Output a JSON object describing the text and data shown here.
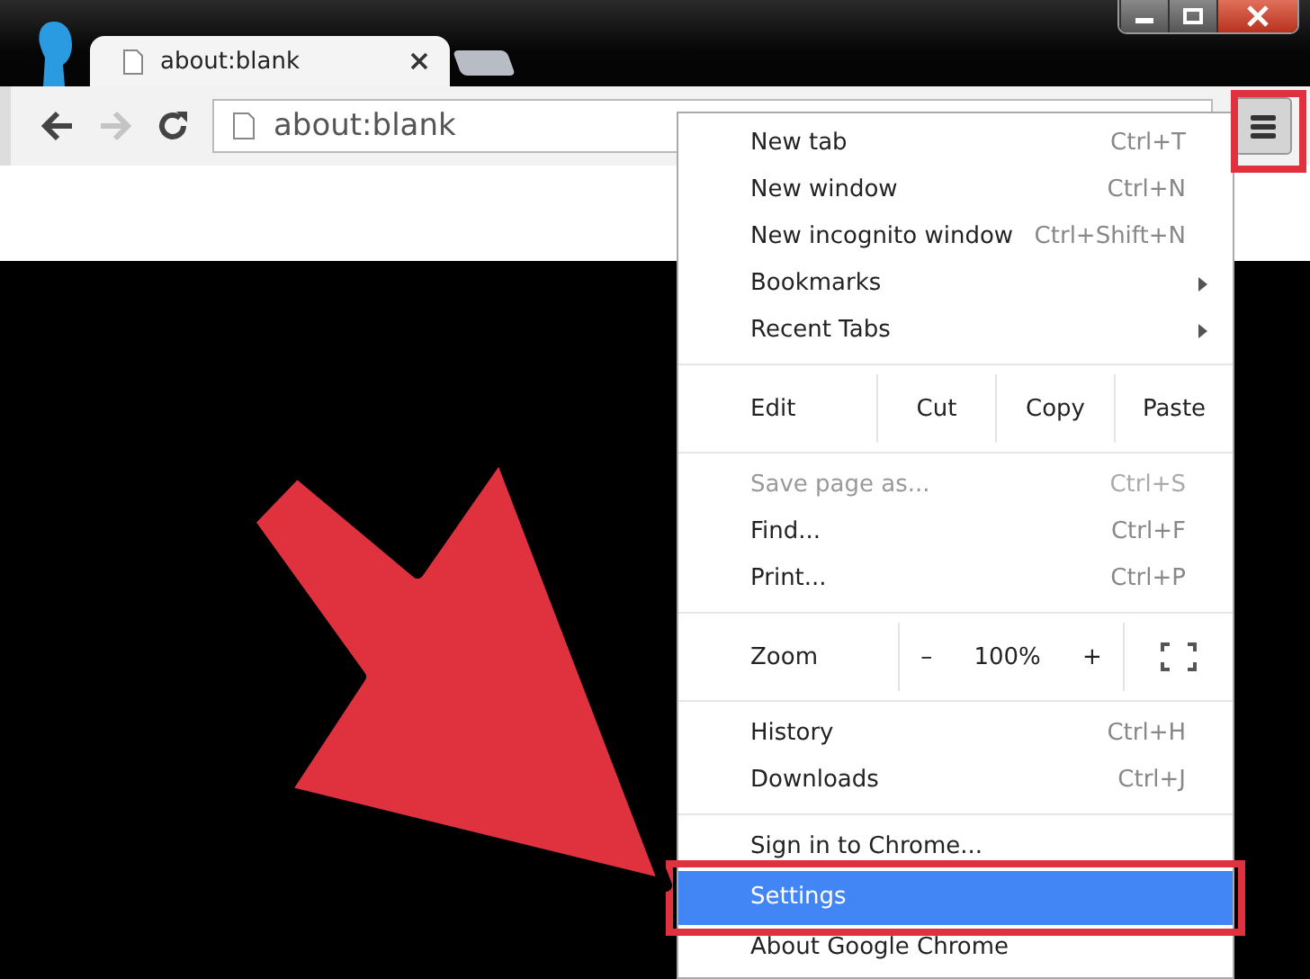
{
  "tabs": [
    {
      "label": "about:blank",
      "selected": true
    }
  ],
  "toolbar": {
    "back_disabled": false,
    "forward_disabled": true,
    "address": "about:blank",
    "menu_button_callout": true
  },
  "menu": [
    {
      "kind": "item",
      "label": "New tab",
      "shortcut": "Ctrl+T",
      "disabled": false,
      "selected": false,
      "callout": false
    },
    {
      "kind": "item",
      "label": "New window",
      "shortcut": "Ctrl+N",
      "disabled": false,
      "selected": false,
      "callout": false
    },
    {
      "kind": "item",
      "label": "New incognito window",
      "shortcut": "Ctrl+Shift+N",
      "disabled": false,
      "selected": false,
      "callout": false
    },
    {
      "kind": "submenu",
      "label": "Bookmarks",
      "disabled": false,
      "selected": false,
      "callout": false
    },
    {
      "kind": "submenu",
      "label": "Recent Tabs",
      "disabled": false,
      "selected": false,
      "callout": false
    },
    {
      "kind": "separator"
    },
    {
      "kind": "edit_row",
      "label": "Edit",
      "buttons": [
        "Cut",
        "Copy",
        "Paste"
      ]
    },
    {
      "kind": "separator"
    },
    {
      "kind": "item",
      "label": "Save page as...",
      "shortcut": "Ctrl+S",
      "disabled": true,
      "selected": false,
      "callout": false
    },
    {
      "kind": "item",
      "label": "Find...",
      "shortcut": "Ctrl+F",
      "disabled": false,
      "selected": false,
      "callout": false
    },
    {
      "kind": "item",
      "label": "Print...",
      "shortcut": "Ctrl+P",
      "disabled": false,
      "selected": false,
      "callout": false
    },
    {
      "kind": "separator"
    },
    {
      "kind": "zoom_row",
      "label": "Zoom",
      "minus": "–",
      "value": "100%",
      "plus": "+"
    },
    {
      "kind": "separator"
    },
    {
      "kind": "item",
      "label": "History",
      "shortcut": "Ctrl+H",
      "disabled": false,
      "selected": false,
      "callout": false
    },
    {
      "kind": "item",
      "label": "Downloads",
      "shortcut": "Ctrl+J",
      "disabled": false,
      "selected": false,
      "callout": false
    },
    {
      "kind": "separator"
    },
    {
      "kind": "item",
      "label": "Sign in to Chrome...",
      "disabled": false,
      "selected": false,
      "callout": false
    },
    {
      "kind": "item",
      "label": "Settings",
      "disabled": false,
      "selected": true,
      "callout": true
    },
    {
      "kind": "item",
      "label": "About Google Chrome",
      "disabled": false,
      "selected": false,
      "callout": false
    }
  ]
}
